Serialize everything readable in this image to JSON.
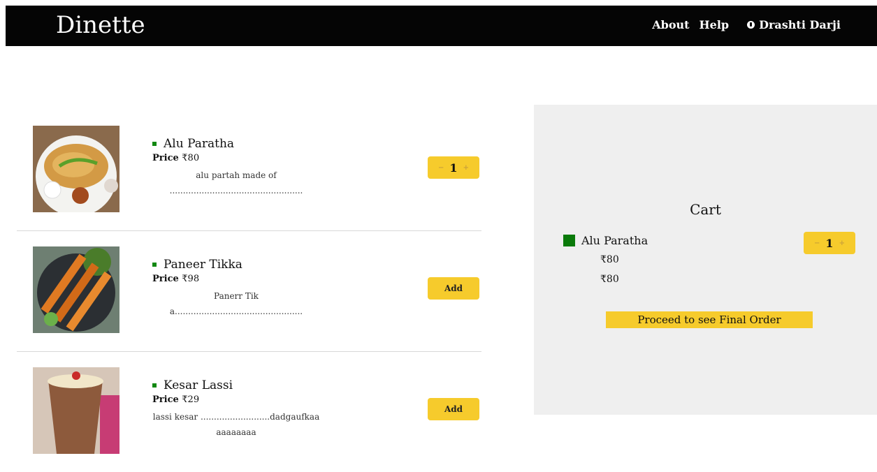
{
  "header": {
    "brand": "Dinette",
    "nav": [
      "About",
      "Help"
    ],
    "user": "Drashti Darji",
    "user_icon": "user-icon"
  },
  "menu": [
    {
      "name": "Alu Paratha",
      "price_label": "Price",
      "price": "₹80",
      "description": "alu partah made of ..................................................",
      "action": "qty",
      "qty": "1"
    },
    {
      "name": "Paneer Tikka",
      "price_label": "Price",
      "price": "₹98",
      "description": "Panerr Tika................................................",
      "action": "add",
      "add_label": "Add"
    },
    {
      "name": "Kesar Lassi",
      "price_label": "Price",
      "price": "₹29",
      "description": "lassi kesar ..........................dadgaufkaaaaaaaaaa",
      "action": "add",
      "add_label": "Add"
    }
  ],
  "cart": {
    "title": "Cart",
    "item_name": "Alu Paratha",
    "qty": "1",
    "unit_price": "₹80",
    "total": "₹80",
    "proceed_label": "Proceed to see Final Order"
  },
  "qty_controls": {
    "minus": "−",
    "plus": "+"
  },
  "colors": {
    "accent": "#f6cb2c",
    "header": "#050505",
    "veg": "#118811",
    "cart_bg": "#efefef"
  }
}
